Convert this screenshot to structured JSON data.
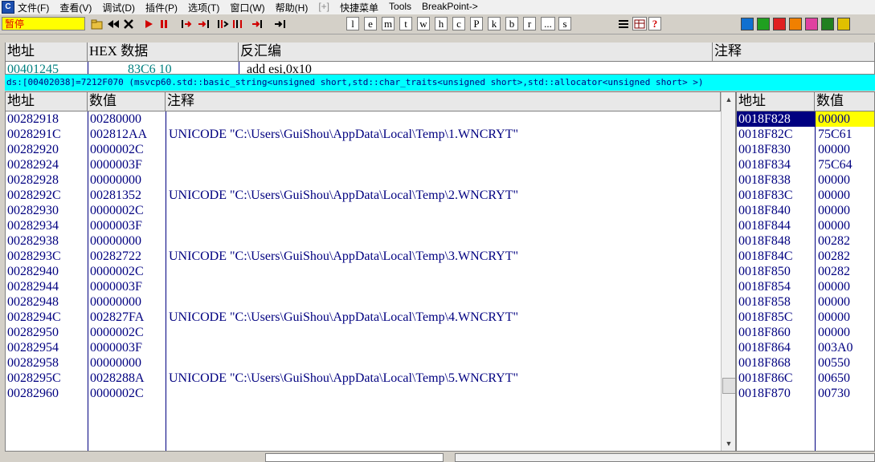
{
  "menu": {
    "items": [
      "文件(F)",
      "查看(V)",
      "调试(D)",
      "插件(P)",
      "选项(T)",
      "窗口(W)",
      "帮助(H)",
      "[+]",
      "快捷菜单",
      "Tools",
      "BreakPoint->"
    ]
  },
  "toolbar": {
    "status": "暂停",
    "letters": [
      "l",
      "e",
      "m",
      "t",
      "w",
      "h",
      "c",
      "P",
      "k",
      "b",
      "r",
      "...",
      "s"
    ],
    "window_icon_colors": [
      "#1070d0",
      "#20a020",
      "#e02020",
      "#f08000",
      "#e040a0",
      "#208020",
      "#e0c000"
    ]
  },
  "cpu": {
    "headers": {
      "address": "地址",
      "hex": "HEX 数据",
      "disasm": "反汇编",
      "comment": "注释"
    },
    "partial_row": {
      "address": "00401245",
      "hex": "83C6 10",
      "disasm": "add esi,0x10"
    }
  },
  "infobar": {
    "text": "ds:[00402038]=7212F070 (msvcp60.std::basic_string<unsigned short,std::char_traits<unsigned short>,std::allocator<unsigned short> >)"
  },
  "dump": {
    "headers": {
      "address": "地址",
      "value": "数值",
      "comment": "注释"
    },
    "rows": [
      {
        "address": "00282918",
        "value": "00280000",
        "comment": ""
      },
      {
        "address": "0028291C",
        "value": "002812AA",
        "comment": "UNICODE \"C:\\Users\\GuiShou\\AppData\\Local\\Temp\\1.WNCRYT\""
      },
      {
        "address": "00282920",
        "value": "0000002C",
        "comment": ""
      },
      {
        "address": "00282924",
        "value": "0000003F",
        "comment": ""
      },
      {
        "address": "00282928",
        "value": "00000000",
        "comment": ""
      },
      {
        "address": "0028292C",
        "value": "00281352",
        "comment": "UNICODE \"C:\\Users\\GuiShou\\AppData\\Local\\Temp\\2.WNCRYT\""
      },
      {
        "address": "00282930",
        "value": "0000002C",
        "comment": ""
      },
      {
        "address": "00282934",
        "value": "0000003F",
        "comment": ""
      },
      {
        "address": "00282938",
        "value": "00000000",
        "comment": ""
      },
      {
        "address": "0028293C",
        "value": "00282722",
        "comment": "UNICODE \"C:\\Users\\GuiShou\\AppData\\Local\\Temp\\3.WNCRYT\""
      },
      {
        "address": "00282940",
        "value": "0000002C",
        "comment": ""
      },
      {
        "address": "00282944",
        "value": "0000003F",
        "comment": ""
      },
      {
        "address": "00282948",
        "value": "00000000",
        "comment": ""
      },
      {
        "address": "0028294C",
        "value": "002827FA",
        "comment": "UNICODE \"C:\\Users\\GuiShou\\AppData\\Local\\Temp\\4.WNCRYT\""
      },
      {
        "address": "00282950",
        "value": "0000002C",
        "comment": ""
      },
      {
        "address": "00282954",
        "value": "0000003F",
        "comment": ""
      },
      {
        "address": "00282958",
        "value": "00000000",
        "comment": ""
      },
      {
        "address": "0028295C",
        "value": "0028288A",
        "comment": "UNICODE \"C:\\Users\\GuiShou\\AppData\\Local\\Temp\\5.WNCRYT\""
      },
      {
        "address": "00282960",
        "value": "0000002C",
        "comment": ""
      }
    ]
  },
  "stack": {
    "headers": {
      "address": "地址",
      "value": "数值"
    },
    "rows": [
      {
        "address": "0018F828",
        "value": "00000"
      },
      {
        "address": "0018F82C",
        "value": "75C61"
      },
      {
        "address": "0018F830",
        "value": "00000"
      },
      {
        "address": "0018F834",
        "value": "75C64"
      },
      {
        "address": "0018F838",
        "value": "00000"
      },
      {
        "address": "0018F83C",
        "value": "00000"
      },
      {
        "address": "0018F840",
        "value": "00000"
      },
      {
        "address": "0018F844",
        "value": "00000"
      },
      {
        "address": "0018F848",
        "value": "00282"
      },
      {
        "address": "0018F84C",
        "value": "00282"
      },
      {
        "address": "0018F850",
        "value": "00282"
      },
      {
        "address": "0018F854",
        "value": "00000"
      },
      {
        "address": "0018F858",
        "value": "00000"
      },
      {
        "address": "0018F85C",
        "value": "00000"
      },
      {
        "address": "0018F860",
        "value": "00000"
      },
      {
        "address": "0018F864",
        "value": "003A0"
      },
      {
        "address": "0018F868",
        "value": "00550"
      },
      {
        "address": "0018F86C",
        "value": "00650"
      },
      {
        "address": "0018F870",
        "value": "00730"
      }
    ],
    "selected_index": 0
  },
  "colors": {
    "text_blue": "#000080",
    "info_cyan": "#00ffff",
    "status_yellow": "#ffff00",
    "selected_bg": "#000080",
    "selected_value_bg": "#ffff00"
  }
}
